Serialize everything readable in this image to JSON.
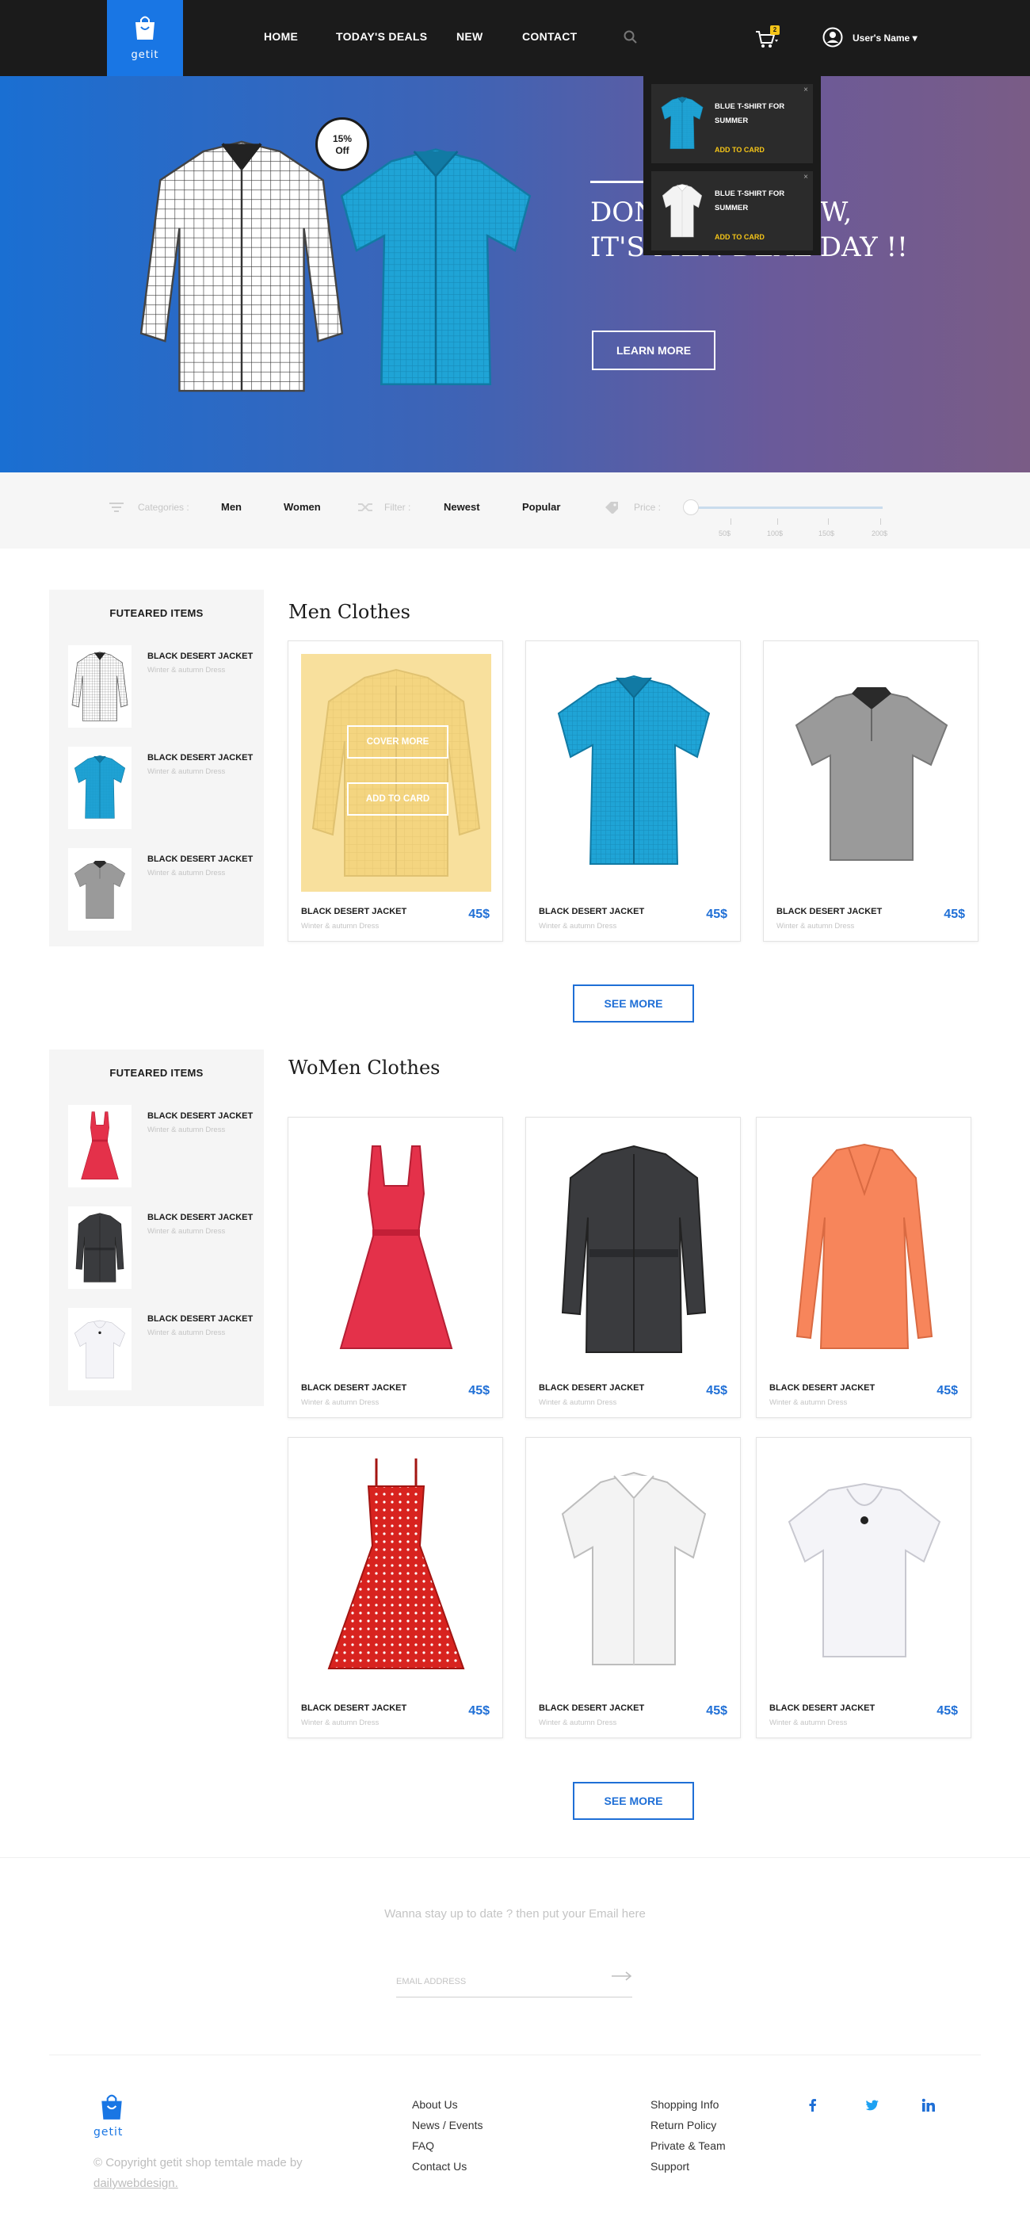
{
  "header": {
    "logo_text": "getit",
    "nav": [
      "HOME",
      "TODAY'S DEALS",
      "NEW",
      "CONTACT"
    ],
    "cart_count": "2",
    "user_name": "User's Name"
  },
  "hero": {
    "badge_line1": "15%",
    "badge_line2": "Off",
    "title_line1": "DON'T MISS NOW,",
    "title_line2": "IT'S MEN DEAL DAY !!",
    "cta": "LEARN MORE"
  },
  "cart_dropdown": {
    "items": [
      {
        "title": "BLUE T-SHIRT FOR SUMMER",
        "action": "ADD TO CARD",
        "close": "×"
      },
      {
        "title": "BLUE T-SHIRT FOR SUMMER",
        "action": "ADD TO CARD",
        "close": "×"
      }
    ]
  },
  "filters": {
    "categories_label": "Categories :",
    "categories": [
      "Men",
      "Women"
    ],
    "filter_label": "Filter :",
    "filter_options": [
      "Newest",
      "Popular"
    ],
    "price_label": "Price :",
    "price_ticks": [
      "50$",
      "100$",
      "150$",
      "200$"
    ]
  },
  "sidebars": [
    {
      "title": "FUTEARED ITEMS",
      "items": [
        {
          "name": "BLACK DESERT JACKET",
          "sub": "Winter & autumn Dress"
        },
        {
          "name": "BLACK DESERT JACKET",
          "sub": "Winter & autumn Dress"
        },
        {
          "name": "BLACK DESERT JACKET",
          "sub": "Winter & autumn Dress"
        }
      ]
    },
    {
      "title": "FUTEARED ITEMS",
      "items": [
        {
          "name": "BLACK DESERT JACKET",
          "sub": "Winter & autumn Dress"
        },
        {
          "name": "BLACK DESERT JACKET",
          "sub": "Winter & autumn Dress"
        },
        {
          "name": "BLACK DESERT JACKET",
          "sub": "Winter & autumn Dress"
        }
      ]
    }
  ],
  "men": {
    "title": "Men Clothes",
    "overlay_cover": "COVER MORE",
    "overlay_add": "ADD TO CARD",
    "products": [
      {
        "name": "BLACK DESERT JACKET",
        "sub": "Winter & autumn Dress",
        "price": "45$"
      },
      {
        "name": "BLACK DESERT JACKET",
        "sub": "Winter & autumn Dress",
        "price": "45$"
      },
      {
        "name": "BLACK DESERT JACKET",
        "sub": "Winter & autumn Dress",
        "price": "45$"
      }
    ],
    "see_more": "SEE MORE"
  },
  "women": {
    "title": "WoMen Clothes",
    "products": [
      {
        "name": "BLACK DESERT JACKET",
        "sub": "Winter & autumn Dress",
        "price": "45$"
      },
      {
        "name": "BLACK DESERT JACKET",
        "sub": "Winter & autumn Dress",
        "price": "45$"
      },
      {
        "name": "BLACK DESERT JACKET",
        "sub": "Winter & autumn Dress",
        "price": "45$"
      },
      {
        "name": "BLACK DESERT JACKET",
        "sub": "Winter & autumn Dress",
        "price": "45$"
      },
      {
        "name": "BLACK DESERT JACKET",
        "sub": "Winter & autumn Dress",
        "price": "45$"
      },
      {
        "name": "BLACK DESERT JACKET",
        "sub": "Winter & autumn Dress",
        "price": "45$"
      }
    ],
    "see_more": "SEE MORE"
  },
  "newsletter": {
    "text": "Wanna stay up to date ? then put your Email here",
    "placeholder": "EMAIL ADDRESS"
  },
  "footer": {
    "logo_text": "getit",
    "copyright": "©  Copyright getit shop temtale made by",
    "copyright_link": "dailywebdesign.",
    "col1": [
      "About Us",
      "News / Events",
      "FAQ",
      "Contact Us"
    ],
    "col2": [
      "Shopping Info",
      "Return Policy",
      "Private & Team",
      "Support"
    ],
    "social": [
      "facebook-icon",
      "twitter-icon",
      "linkedin-icon"
    ]
  },
  "colors": {
    "accent": "#1f6fd6",
    "header_bg": "#1b1b1b",
    "badge": "#f5c518",
    "hero_start": "#1a6fd2",
    "hero_end": "#7a5c86"
  }
}
